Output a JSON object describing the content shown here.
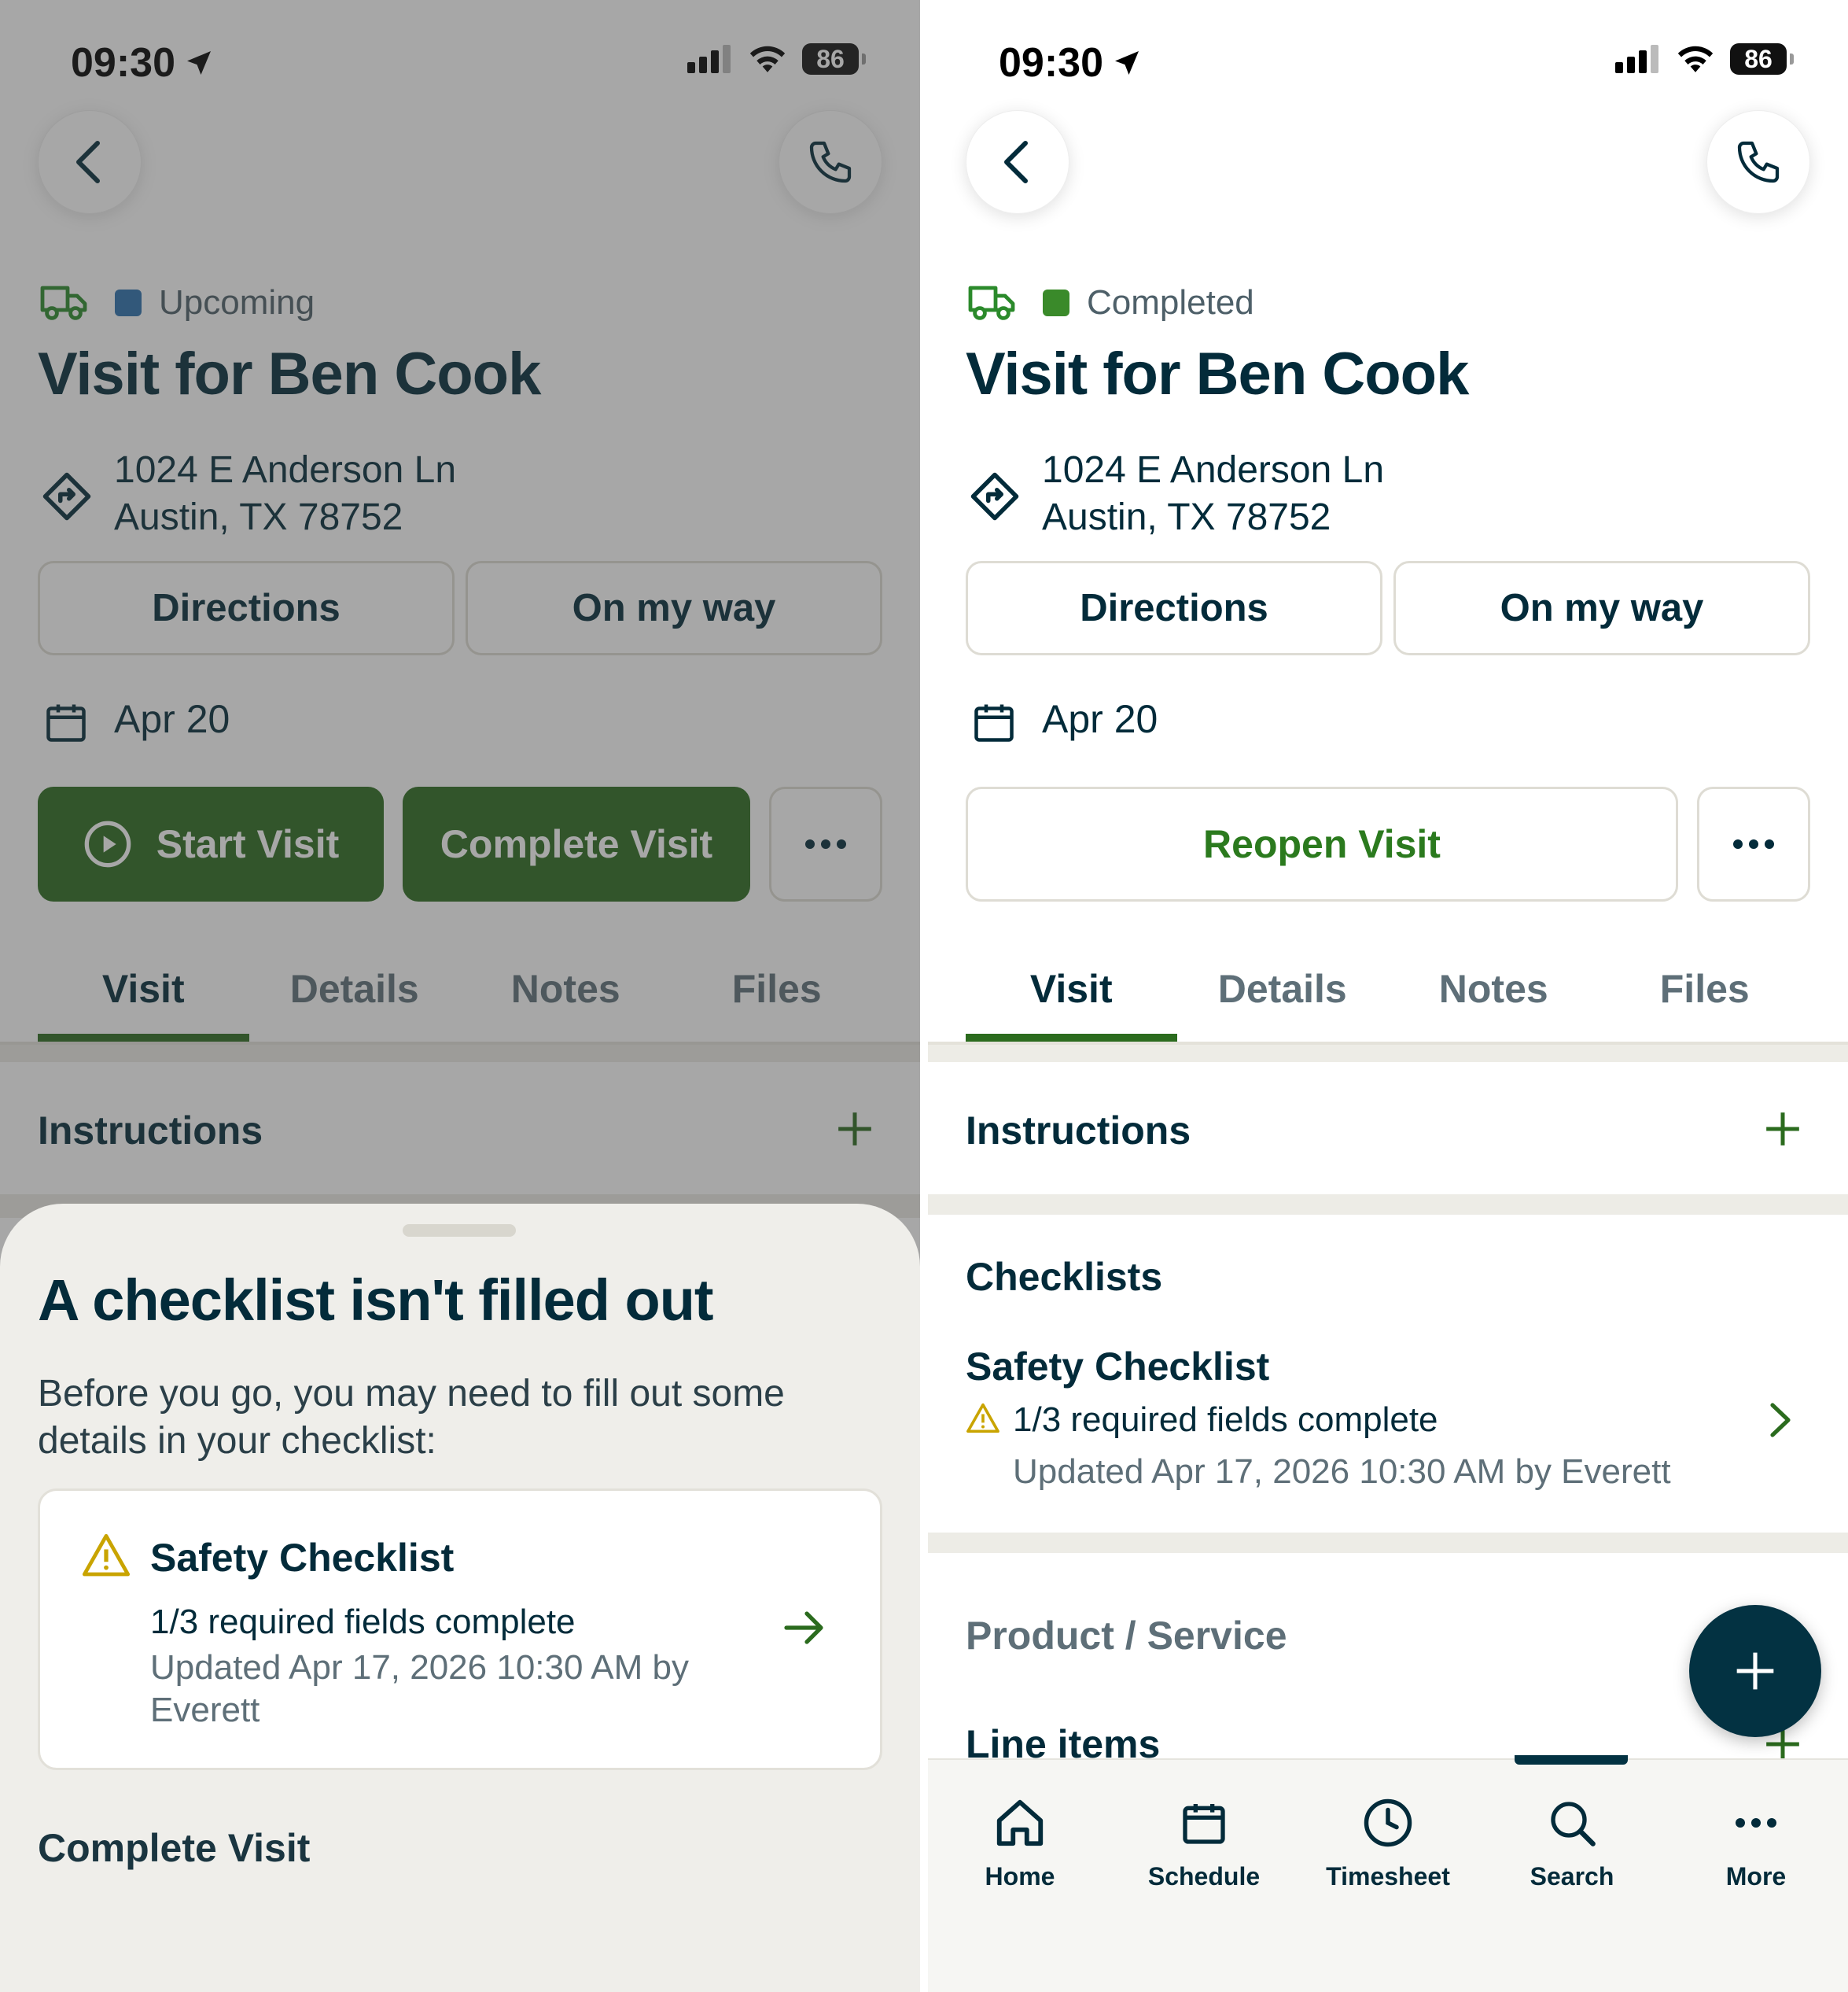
{
  "status_bar": {
    "time": "09:30",
    "battery": "86"
  },
  "left": {
    "status_label": "Upcoming",
    "status_color": "#2a6fae",
    "title": "Visit for Ben Cook",
    "address_line1": "1024 E Anderson Ln",
    "address_line2": "Austin, TX 78752",
    "directions_label": "Directions",
    "on_my_way_label": "On my way",
    "date": "Apr 20",
    "start_visit_label": "Start Visit",
    "complete_visit_label": "Complete Visit",
    "tabs": [
      "Visit",
      "Details",
      "Notes",
      "Files"
    ],
    "instructions_label": "Instructions",
    "sheet": {
      "title": "A checklist isn't filled out",
      "body": "Before you go, you may need to fill out some details in your checklist:",
      "card_title": "Safety Checklist",
      "card_progress": "1/3 required fields complete",
      "card_updated": "Updated Apr 17, 2026 10:30 AM by Everett",
      "complete_visit_label": "Complete Visit"
    }
  },
  "right": {
    "status_label": "Completed",
    "status_color": "#3a8a2a",
    "title": "Visit for Ben Cook",
    "address_line1": "1024 E Anderson Ln",
    "address_line2": "Austin, TX 78752",
    "directions_label": "Directions",
    "on_my_way_label": "On my way",
    "date": "Apr 20",
    "reopen_visit_label": "Reopen Visit",
    "tabs": [
      "Visit",
      "Details",
      "Notes",
      "Files"
    ],
    "instructions_label": "Instructions",
    "checklists_label": "Checklists",
    "checklist_title": "Safety Checklist",
    "checklist_progress": "1/3 required fields complete",
    "checklist_updated": "Updated Apr 17, 2026 10:30 AM by Everett",
    "product_service_label": "Product / Service",
    "line_items_label": "Line items",
    "nav": [
      "Home",
      "Schedule",
      "Timesheet",
      "Search",
      "More"
    ]
  }
}
